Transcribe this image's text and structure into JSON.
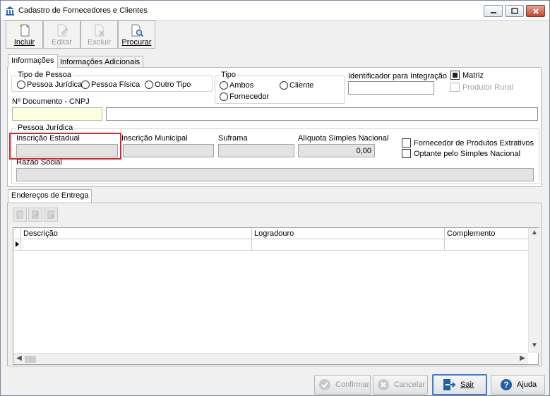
{
  "window": {
    "title": "Cadastro de Fornecedores e Clientes",
    "controls": [
      "minimize",
      "maximize",
      "close"
    ]
  },
  "toolbar": {
    "incluir": "Incluir",
    "editar": "Editar",
    "excluir": "Excluir",
    "procurar": "Procurar"
  },
  "tabs": {
    "informacoes": "Informações",
    "adicionais": "Informações Adicionais"
  },
  "tipo_pessoa": {
    "title": "Tipo de Pessoa",
    "juridica": "Pessoa Jurídica",
    "fisica": "Pessoa Física",
    "outro": "Outro Tipo"
  },
  "tipo": {
    "title": "Tipo",
    "ambos": "Ambos",
    "cliente": "Cliente",
    "fornecedor": "Fornecedor"
  },
  "integracao": {
    "label": "Identificador para Integração",
    "value": ""
  },
  "matriz": {
    "label": "Matriz",
    "checked": true
  },
  "produtor_rural": {
    "label": "Produtor Rural",
    "checked": false,
    "enabled": false
  },
  "documento": {
    "label": "Nº Documento - CNPJ",
    "value": "",
    "name_value": ""
  },
  "pessoa_juridica": {
    "title": "Pessoa Jurídica",
    "inscricao_estadual": {
      "label": "Inscrição Estadual",
      "value": ""
    },
    "inscricao_municipal": {
      "label": "Inscrição Municipal",
      "value": ""
    },
    "suframa": {
      "label": "Suframa",
      "value": ""
    },
    "aliquota": {
      "label": "Alíquota Simples Nacional",
      "value": "0,00"
    },
    "fornecedor_extrativos": "Fornecedor de Produtos Extrativos",
    "optante_simples": "Optante pelo Simples Nacional",
    "razao_social": {
      "label": "Razão Social",
      "value": ""
    }
  },
  "enderecos": {
    "tab": "Endereços de Entrega",
    "columns": [
      "Descrição",
      "Logradouro",
      "Complemento"
    ],
    "rows": [
      [
        "",
        "",
        ""
      ]
    ]
  },
  "bottom": {
    "confirmar": "Confirmar",
    "cancelar": "Cancelar",
    "sair": "Sair",
    "ajuda": "Ajuda"
  },
  "colors": {
    "highlight": "#d9252b",
    "required_field": "#ffffe1",
    "focus": "#3d7bd4"
  }
}
